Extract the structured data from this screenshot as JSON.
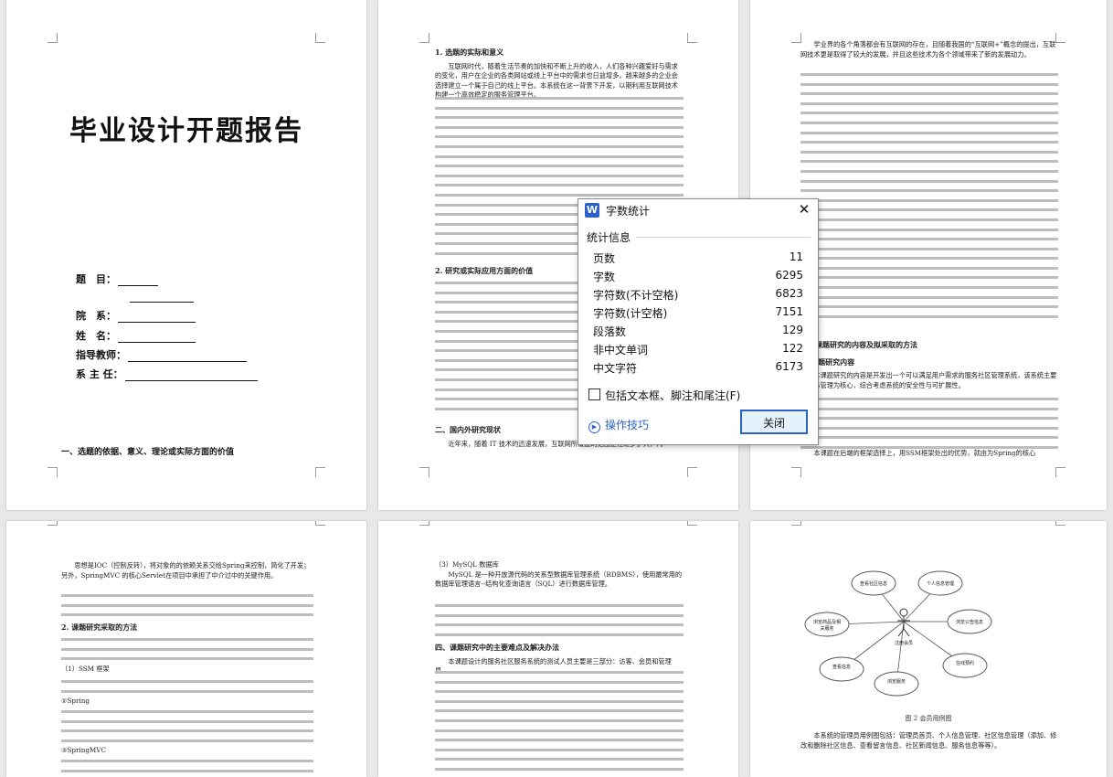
{
  "cover": {
    "title": "毕业设计开题报告",
    "fields": [
      "题　目：",
      "院　系：",
      "姓　名：",
      "指导教师：",
      "系 主 任："
    ],
    "section": "一、选题的依据、意义、理论或实际方面的价值"
  },
  "page2": {
    "heading1": "1. 选题的实际和意义",
    "para1": "互联网时代，随着生活节奏的加快和不断上升的收入，人们各种兴趣爱好与需求的变化，用户在企业的各类网站或线上平台中的需求也日益增多，越来越多的企业会选择建立一个属于自己的线上平台。本系统在这一背景下开发，以期利用互联网技术构建一个高效稳定的服务管理平台。",
    "heading2": "2. 研究或实际应用方面的价值",
    "heading3": "二、国内外研究现状",
    "para2": "近年来，随着 IT 技术的迅速发展，互联网所覆盖的范围正在逐步扩大，几"
  },
  "page3": {
    "para1": "学业界的各个角落都会有互联网的存在，且随着我国的“互联网+”概念的提出，互联网技术更是取得了较大的发展，并且这些技术为各个领域带来了新的发展动力。",
    "heading1": "三、课题研究的内容及拟采取的方法",
    "heading2": "1. 课题研究内容",
    "para2": "本课题研究的内容是开发出一个可以满足用户需求的服务社区管理系统，该系统主要以服务管理为核心，综合考虑系统的安全性与可扩展性。",
    "para3": "本课题在后端的框架选择上，用SSM框架处出的优势，就由为Spring的核心"
  },
  "page4": {
    "para1": "思想是IOC（控制反转），将对象的的依赖关系交给Spring来控制，简化了开发；另外，SpringMVC 的核心Servlet在项目中承担了中介过中的关键作用。",
    "heading": "2. 课题研究采取的方法",
    "item1": "（1）SSM 框架",
    "item2": "②Spring",
    "item3": "③SpringMVC"
  },
  "page5": {
    "item": "（3）MySQL 数据库",
    "para1": "MySQL 是一种开放源代码的关系型数据库管理系统（RDBMS），使用最常用的数据库管理语言--结构化查询语言（SQL）进行数据库管理。",
    "heading": "四、课题研究中的主要难点及解决办法",
    "para2": "本课题设计的服务社区服务系统的测试人员主要是三部分：访客、会员和管理员。"
  },
  "page6": {
    "nodes": [
      "查看社区信息",
      "个人信息管理",
      "浏览公告信息",
      "浏览商品及相关服务",
      "查看信息",
      "浏览服务",
      "在线预约",
      "浏览社区信息"
    ],
    "actor": "注册会员",
    "caption": "图 2 会员用例图",
    "para": "本系统的管理员用例图包括：管理员首页、个人信息管理、社区信息管理（添加、修改和删除社区信息、查看留言信息、社区新闻信息、服务信息等等）。"
  },
  "dialog": {
    "title": "字数统计",
    "group": "统计信息",
    "stats": [
      {
        "label": "页数",
        "value": "11"
      },
      {
        "label": "字数",
        "value": "6295"
      },
      {
        "label": "字符数(不计空格)",
        "value": "6823"
      },
      {
        "label": "字符数(计空格)",
        "value": "7151"
      },
      {
        "label": "段落数",
        "value": "129"
      },
      {
        "label": "非中文单词",
        "value": "122"
      },
      {
        "label": "中文字符",
        "value": "6173"
      }
    ],
    "checkbox_label": "包括文本框、脚注和尾注(F)",
    "tips_label": "操作技巧",
    "close_label": "关闭",
    "icon": "W"
  }
}
